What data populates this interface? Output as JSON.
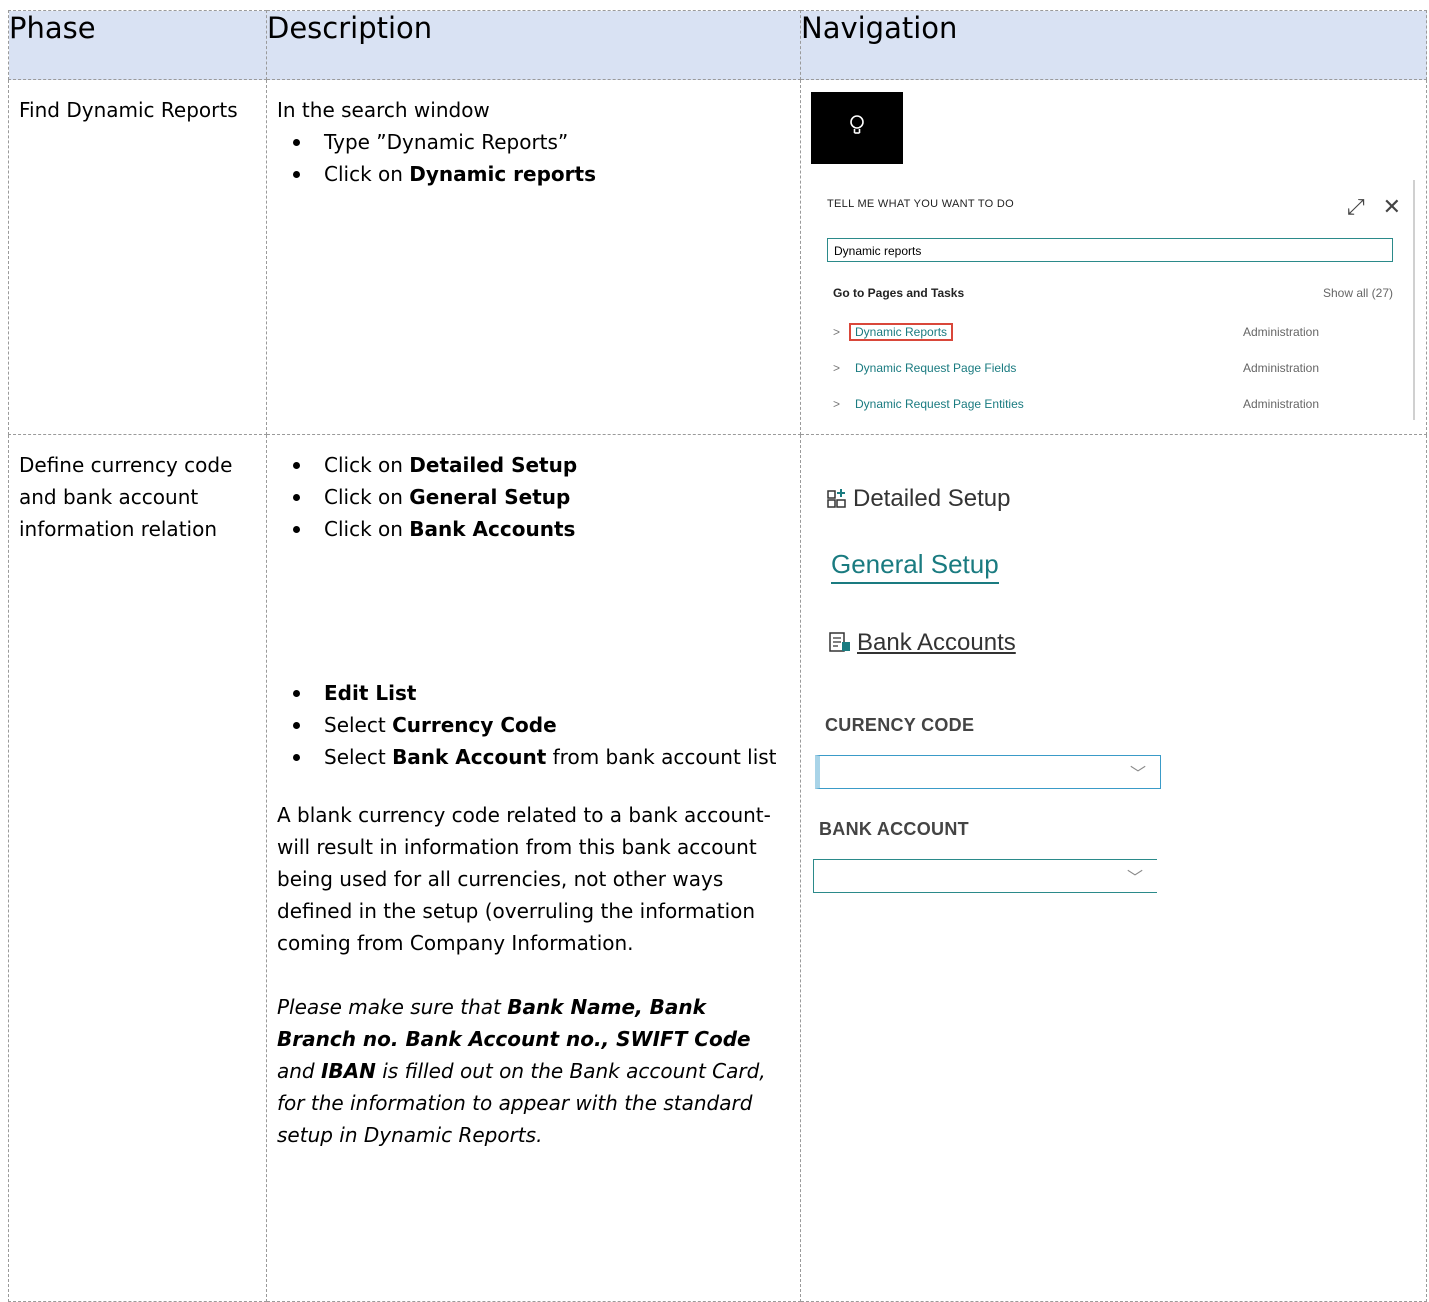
{
  "headers": {
    "phase": "Phase",
    "description": "Description",
    "navigation": "Navigation"
  },
  "row1": {
    "phase": "Find Dynamic Reports",
    "intro": "In the search window",
    "b1_pre": "Type ”Dynamic Reports”",
    "b2_pre": "Click on ",
    "b2_bold": "Dynamic reports",
    "nav": {
      "icon": "lightbulb-icon",
      "title": "TELL ME WHAT YOU WANT TO DO",
      "expand_icon": "expand-icon",
      "close_icon": "close-icon",
      "search_value": "Dynamic reports",
      "group_label": "Go to Pages and Tasks",
      "show_all": "Show all (27)",
      "results": [
        {
          "label": "Dynamic Reports",
          "category": "Administration"
        },
        {
          "label": "Dynamic Request Page Fields",
          "category": "Administration"
        },
        {
          "label": "Dynamic Request Page Entities",
          "category": "Administration"
        }
      ]
    }
  },
  "row2": {
    "phase": "Define currency code and bank account information relation",
    "b1_pre": "Click on ",
    "b1_bold": "Detailed Setup",
    "b2_pre": "Click on ",
    "b2_bold": "General Setup",
    "b3_pre": "Click on ",
    "b3_bold": "Bank Accounts",
    "b4_bold": "Edit List",
    "b5_pre": "Select ",
    "b5_bold": "Currency Code",
    "b6_pre": "Select ",
    "b6_bold": "Bank Account",
    "b6_post": " from bank account list",
    "note": "A blank currency code related to a bank account- will result in information from this bank account being used for all currencies, not other ways defined in the setup (overruling the information coming from Company Information.",
    "italic_pre": "Please make sure that ",
    "italic_bold": "Bank Name, Bank Branch no. Bank Account no., SWIFT Code",
    "italic_mid": " and ",
    "italic_bold2": "IBAN",
    "italic_post": " is filled out on the Bank account Card, for the information to appear with the standard setup in Dynamic Reports.",
    "nav": {
      "detailed_setup": "Detailed Setup",
      "general_setup": "General Setup",
      "bank_accounts": "Bank Accounts",
      "currency_label": "CURENCY CODE",
      "bank_label": "BANK ACCOUNT",
      "accent": "#1a7b80"
    }
  }
}
